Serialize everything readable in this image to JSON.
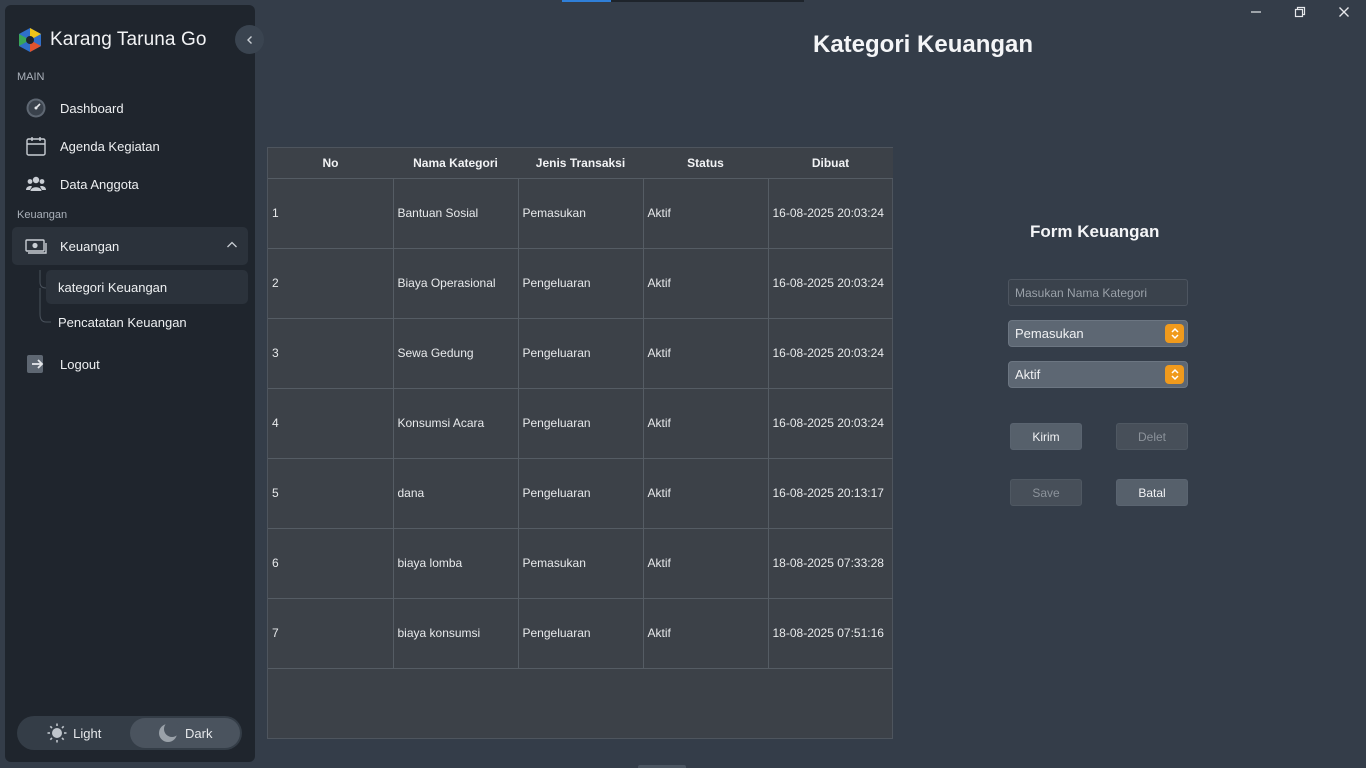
{
  "app": {
    "title": "Karang Taruna Go"
  },
  "sidebar": {
    "section_main": "MAIN",
    "section_finance": "Keuangan",
    "items": [
      {
        "label": "Dashboard",
        "icon": "dashboard-gauge-icon"
      },
      {
        "label": "Agenda Kegiatan",
        "icon": "calendar-icon"
      },
      {
        "label": "Data Anggota",
        "icon": "users-icon"
      },
      {
        "label": "Keuangan",
        "icon": "money-icon",
        "expanded": true
      },
      {
        "label": "Logout",
        "icon": "logout-icon"
      }
    ],
    "subitems": [
      {
        "label": "kategori Keuangan",
        "active": true
      },
      {
        "label": "Pencatatan Keuangan",
        "active": false
      }
    ],
    "theme": {
      "light_label": "Light",
      "dark_label": "Dark",
      "selected": "Dark"
    }
  },
  "page": {
    "title": "Kategori Keuangan"
  },
  "table": {
    "columns": [
      "No",
      "Nama Kategori",
      "Jenis Transaksi",
      "Status",
      "Dibuat"
    ],
    "rows": [
      [
        "1",
        "Bantuan Sosial",
        "Pemasukan",
        "Aktif",
        "16-08-2025 20:03:24"
      ],
      [
        "2",
        "Biaya Operasional",
        "Pengeluaran",
        "Aktif",
        "16-08-2025 20:03:24"
      ],
      [
        "3",
        "Sewa Gedung",
        "Pengeluaran",
        "Aktif",
        "16-08-2025 20:03:24"
      ],
      [
        "4",
        "Konsumsi Acara",
        "Pengeluaran",
        "Aktif",
        "16-08-2025 20:03:24"
      ],
      [
        "5",
        "dana",
        "Pengeluaran",
        "Aktif",
        "16-08-2025 20:13:17"
      ],
      [
        "6",
        "biaya lomba",
        "Pemasukan",
        "Aktif",
        "18-08-2025 07:33:28"
      ],
      [
        "7",
        "biaya konsumsi",
        "Pengeluaran",
        "Aktif",
        "18-08-2025 07:51:16"
      ]
    ]
  },
  "form": {
    "title": "Form Keuangan",
    "name_placeholder": "Masukan Nama Kategori",
    "name_value": "",
    "jenis_selected": "Pemasukan",
    "status_selected": "Aktif",
    "buttons": {
      "kirim": "Kirim",
      "delet": "Delet",
      "save": "Save",
      "batal": "Batal"
    }
  },
  "colors": {
    "background": "#343d49",
    "sidebar": "#1f252d",
    "accent_orange": "#f09a1c",
    "accent_blue": "#2f7fd8"
  }
}
